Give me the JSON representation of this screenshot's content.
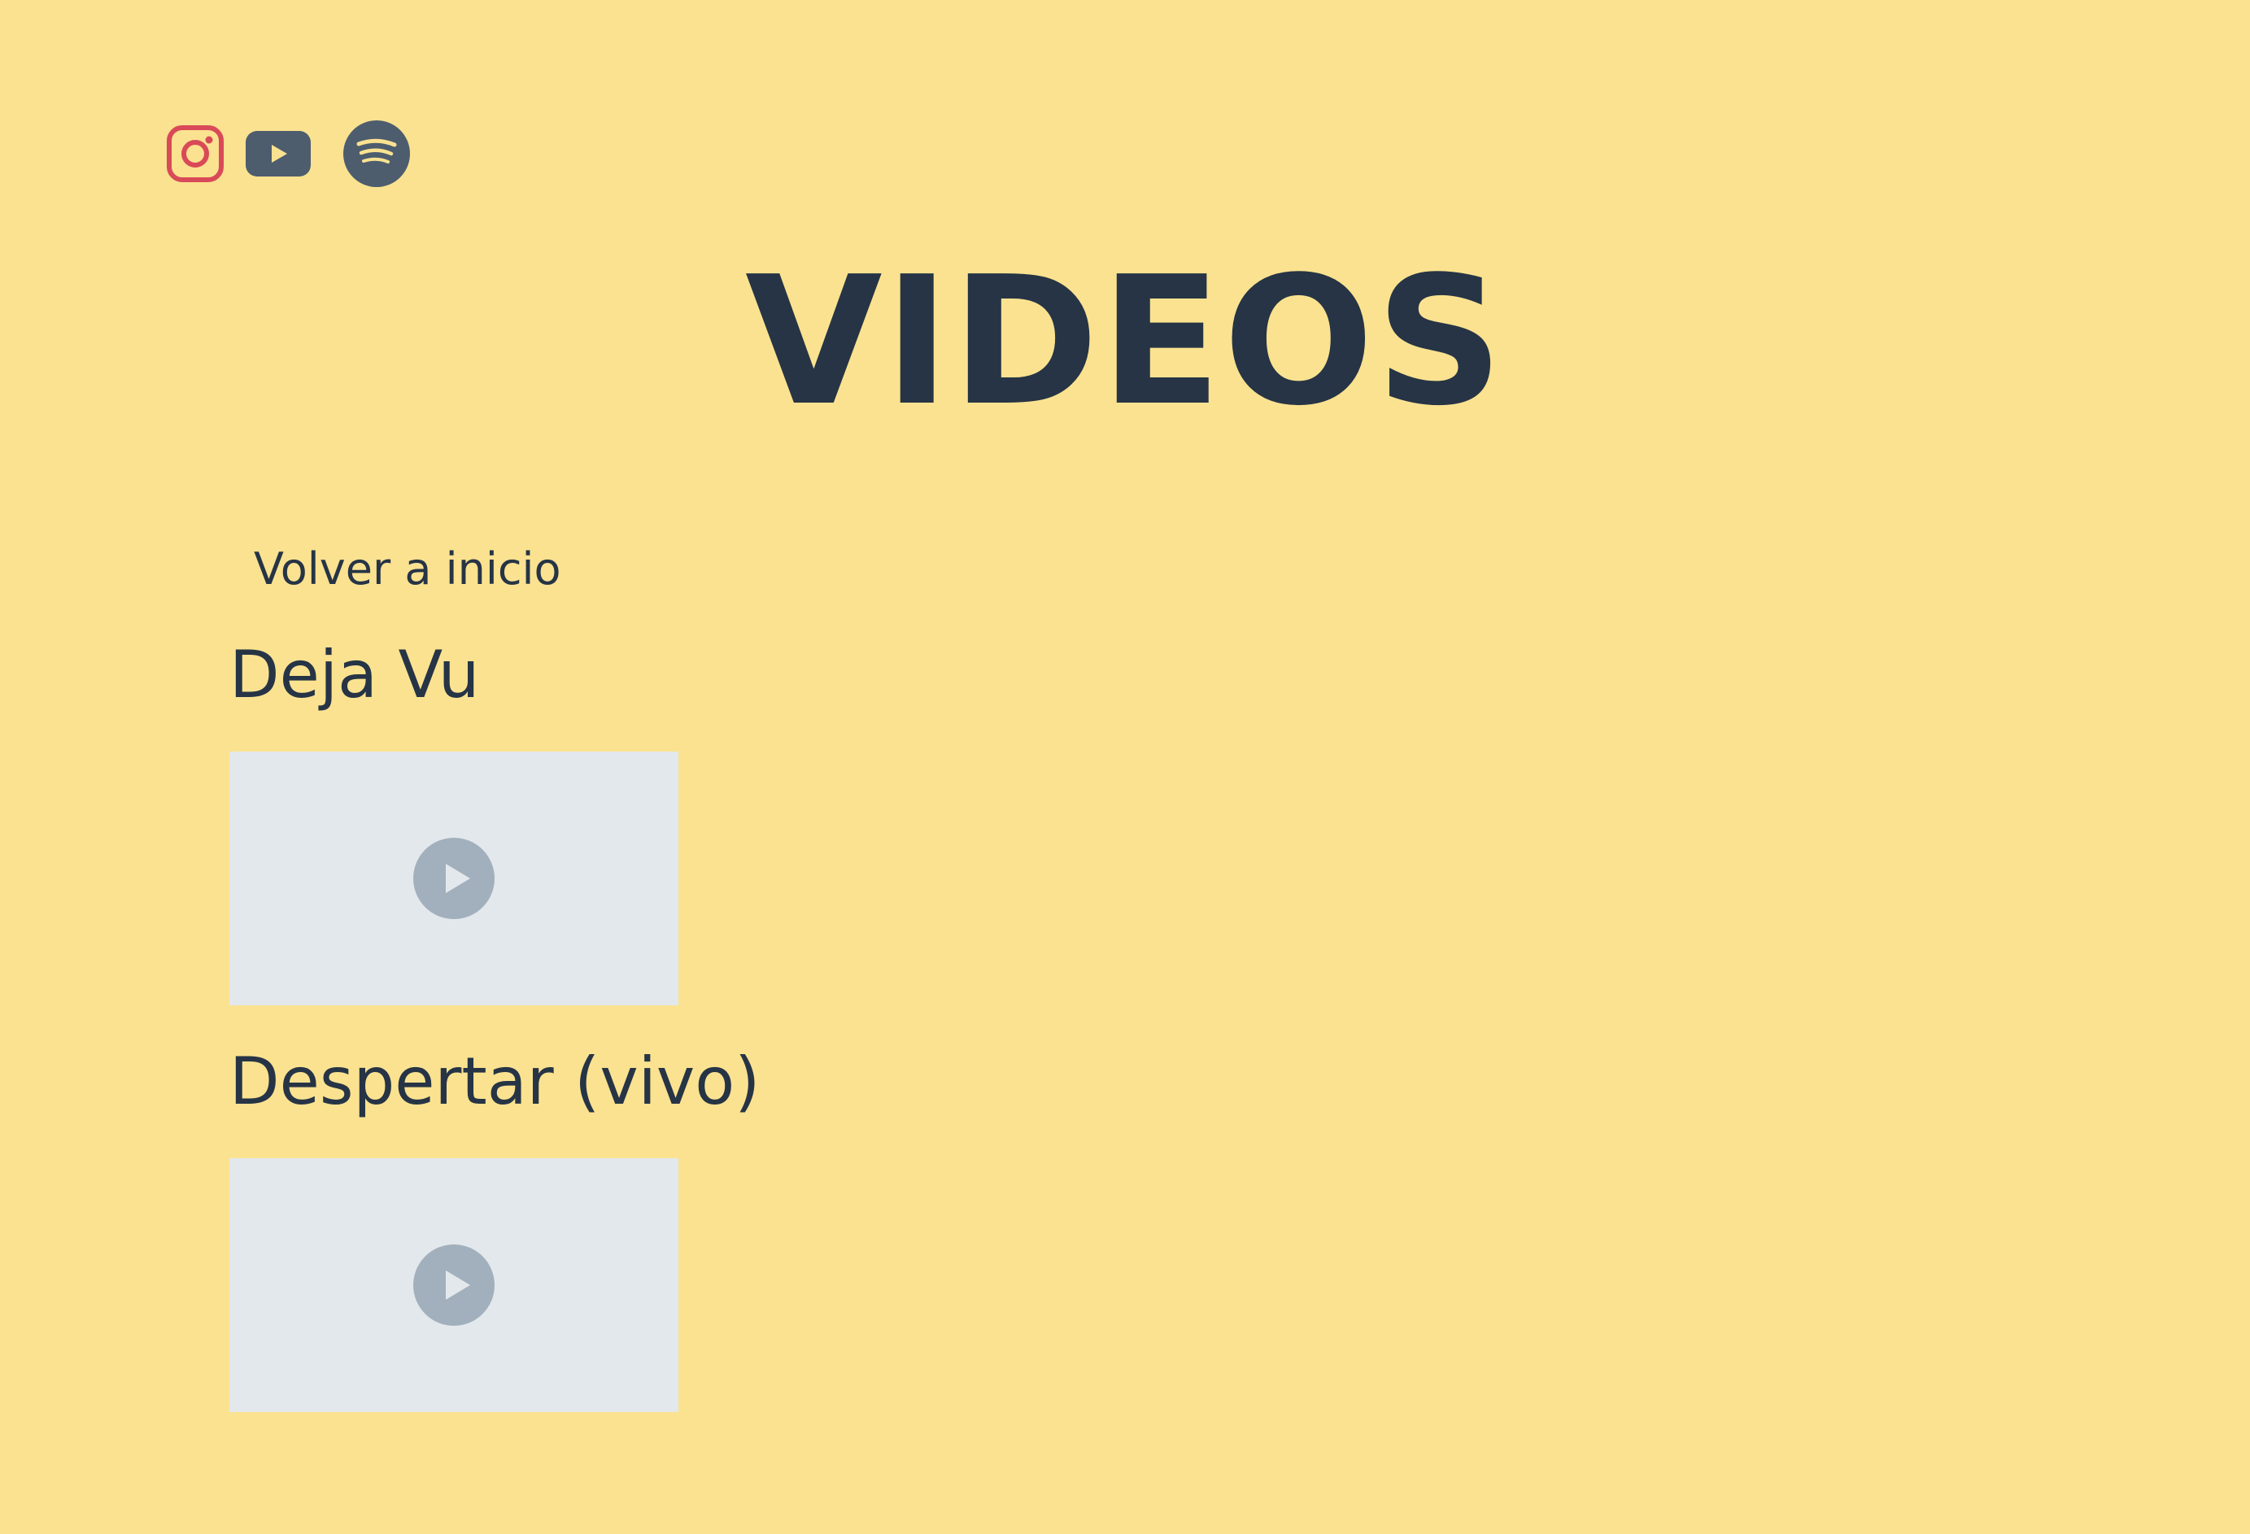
{
  "colors": {
    "background": "#fae290",
    "text": "#263445",
    "instagram": "#d94a58",
    "icon_dark": "#4d5d6e",
    "video_placeholder": "#e3e8ec",
    "play_button": "#a2b0bd"
  },
  "social": [
    {
      "name": "Instagram",
      "icon": "instagram-icon"
    },
    {
      "name": "YouTube",
      "icon": "youtube-icon"
    },
    {
      "name": "Spotify",
      "icon": "spotify-icon"
    }
  ],
  "page": {
    "title": "VIDEOS",
    "back_link": "Volver a inicio"
  },
  "videos": [
    {
      "title": "Deja Vu",
      "icon": "play-icon"
    },
    {
      "title": "Despertar (vivo)",
      "icon": "play-icon"
    }
  ]
}
